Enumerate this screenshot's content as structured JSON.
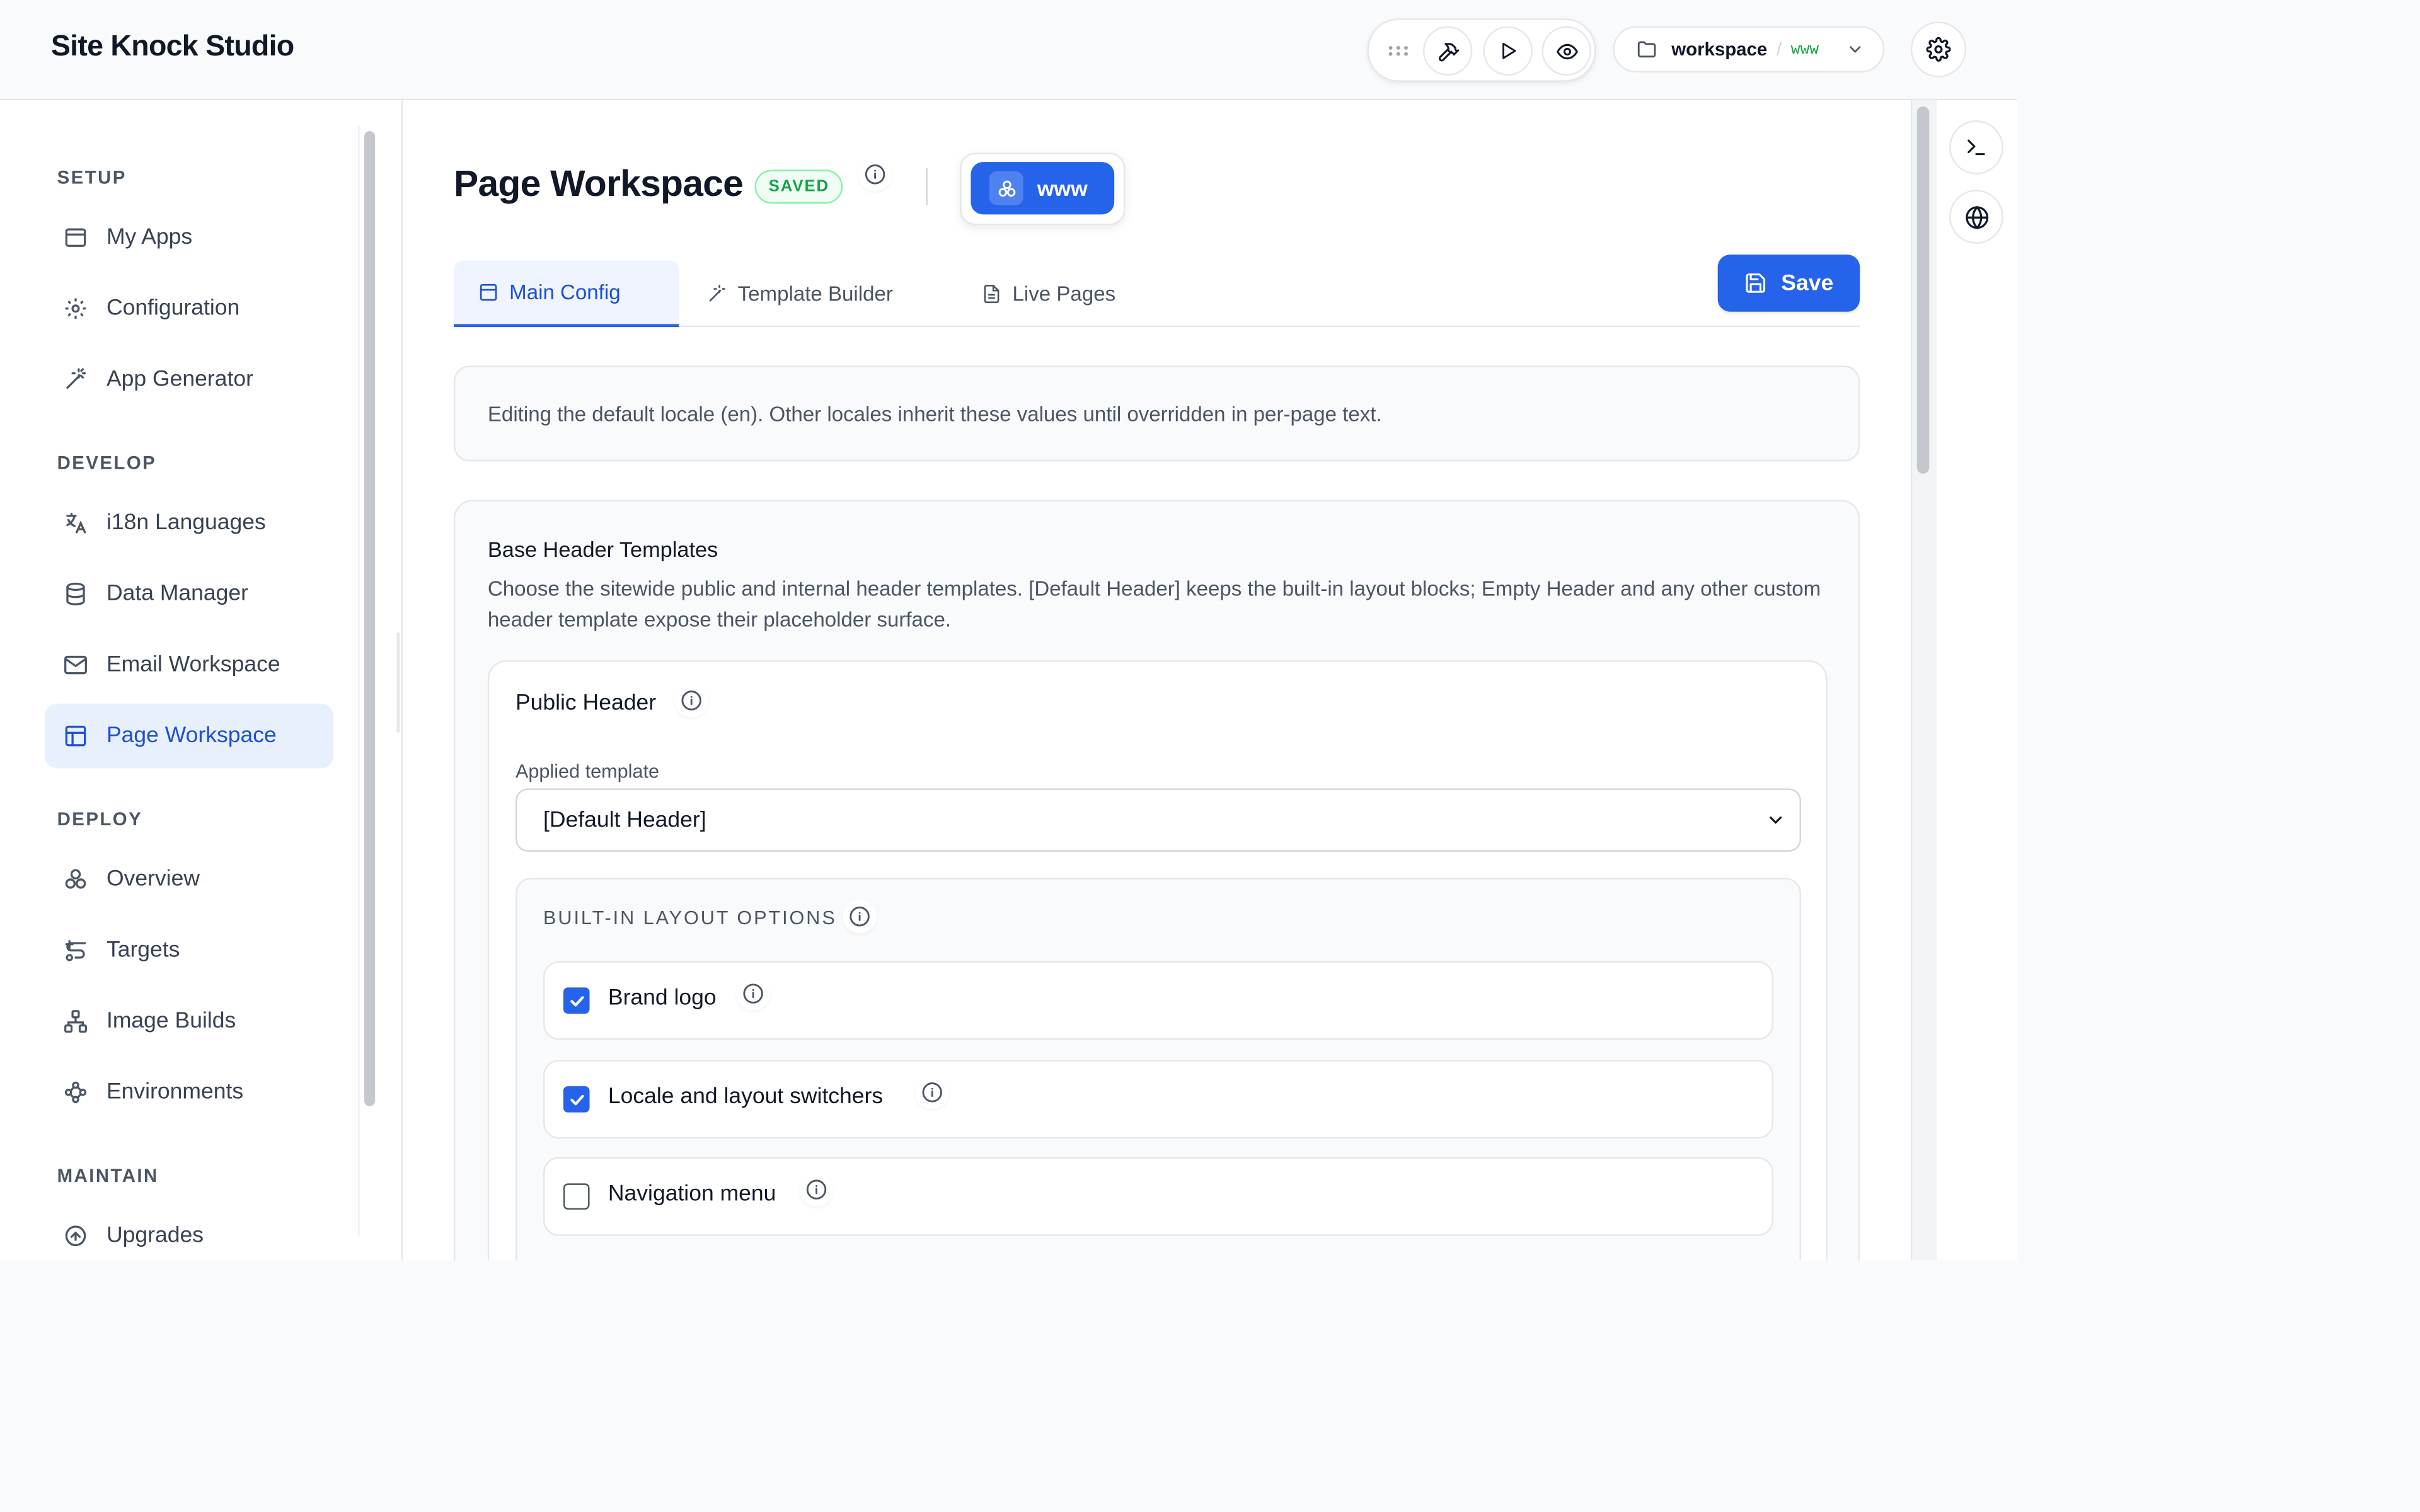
{
  "app": {
    "brand": "Site Knock Studio"
  },
  "topbar": {
    "workspace_name": "workspace",
    "workspace_sep": "/",
    "workspace_env": "www"
  },
  "sidebar": {
    "sections": [
      {
        "title": "SETUP",
        "items": [
          {
            "label": "My Apps",
            "icon": "app-window-icon"
          },
          {
            "label": "Configuration",
            "icon": "gear-icon"
          },
          {
            "label": "App Generator",
            "icon": "magic-wand-icon"
          }
        ]
      },
      {
        "title": "DEVELOP",
        "items": [
          {
            "label": "i18n Languages",
            "icon": "translate-icon"
          },
          {
            "label": "Data Manager",
            "icon": "database-icon"
          },
          {
            "label": "Email Workspace",
            "icon": "mail-icon"
          },
          {
            "label": "Page Workspace",
            "icon": "layout-icon",
            "active": true
          }
        ]
      },
      {
        "title": "DEPLOY",
        "items": [
          {
            "label": "Overview",
            "icon": "cluster-icon"
          },
          {
            "label": "Targets",
            "icon": "target-route-icon"
          },
          {
            "label": "Image Builds",
            "icon": "network-icon"
          },
          {
            "label": "Environments",
            "icon": "workflow-icon"
          }
        ]
      },
      {
        "title": "MAINTAIN",
        "items": [
          {
            "label": "Upgrades",
            "icon": "upgrade-icon"
          }
        ]
      }
    ]
  },
  "page": {
    "title": "Page Workspace",
    "status_badge": "SAVED",
    "env_label": "www",
    "tabs": [
      {
        "label": "Main Config",
        "icon": "layout-icon",
        "active": true
      },
      {
        "label": "Template Builder",
        "icon": "magic-wand-icon"
      },
      {
        "label": "Live Pages",
        "icon": "file-icon"
      }
    ],
    "save_label": "Save",
    "notice": "Editing the default locale (en). Other locales inherit these values until overridden in per-page text."
  },
  "header_templates": {
    "title": "Base Header Templates",
    "description": "Choose the sitewide public and internal header templates. [Default Header] keeps the built-in layout blocks; Empty Header and any other custom header template expose their placeholder surface.",
    "public_header": {
      "title": "Public Header",
      "field_label": "Applied template",
      "selected": "[Default Header]",
      "layout_heading": "BUILT-IN LAYOUT OPTIONS",
      "options": [
        {
          "label": "Brand logo",
          "checked": true
        },
        {
          "label": "Locale and layout switchers",
          "checked": true
        },
        {
          "label": "Navigation menu",
          "checked": false
        }
      ]
    }
  },
  "colors": {
    "accent": "#2563eb",
    "active_bg": "#e8f0fe",
    "saved_green": "#16a34a"
  }
}
